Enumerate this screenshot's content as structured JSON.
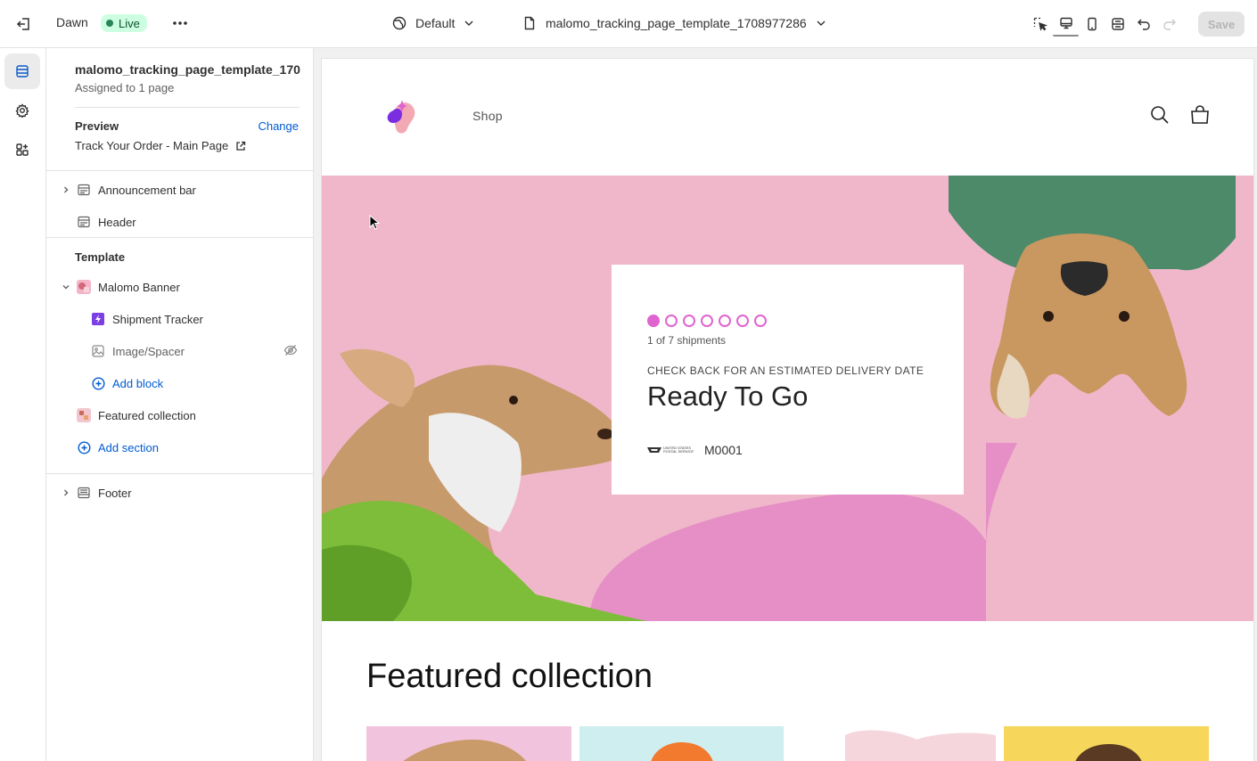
{
  "topbar": {
    "theme_name": "Dawn",
    "live_label": "Live",
    "language_label": "Default",
    "template_label": "malomo_tracking_page_template_1708977286",
    "save_label": "Save"
  },
  "sidebar": {
    "title": "malomo_tracking_page_template_170",
    "assigned": "Assigned to 1 page",
    "preview_label": "Preview",
    "change_label": "Change",
    "preview_page": "Track Your Order - Main Page",
    "announcement_bar": "Announcement bar",
    "header": "Header",
    "template_label": "Template",
    "malomo_banner": "Malomo Banner",
    "shipment_tracker": "Shipment Tracker",
    "image_spacer": "Image/Spacer",
    "add_block": "Add block",
    "featured_collection": "Featured collection",
    "add_section": "Add section",
    "footer": "Footer"
  },
  "store": {
    "nav_shop": "Shop",
    "shipment_count": "1 of 7 shipments",
    "check_back": "CHECK BACK FOR AN ESTIMATED DELIVERY DATE",
    "status": "Ready To Go",
    "carrier_logo_text": "UNITED STATES POSTAL SERVICE",
    "tracking_code": "M0001",
    "shipments_total": 7,
    "shipments_current": 1,
    "featured_title": "Featured collection"
  },
  "colors": {
    "accent": "#005bd3",
    "live_bg": "#cdfee1",
    "live_dot": "#29845a",
    "banner_pink": "#f0b7cb",
    "tracker_magenta": "#e064cf"
  }
}
